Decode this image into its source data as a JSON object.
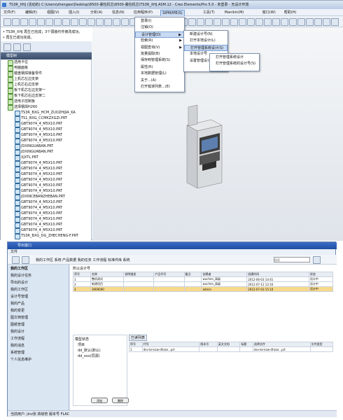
{
  "app": {
    "title": "TS3R_XHJ (活动的) C:\\Users\\zhengwx\\Desktop\\8500-暴柱机芯\\8500-暴柱机芯\\TS3R_XHJ.ASM.12 - Creo Elements/Pro 5.0 - 未登录 - 无设计环境"
  },
  "menubar": [
    "文件(F)",
    "编辑(E)",
    "视图(V)",
    "插入(I)",
    "分析(A)",
    "信息(N)",
    "应用程序(P)",
    "SIPM/IPE(S)",
    "工具(T)",
    "Manikin(M)",
    "窗口(W)",
    "帮助(H)"
  ],
  "messages": [
    "• TS3R_XHJ 再生已完成；3个弱装约件被改成功。",
    "• 再生已成功完成。"
  ],
  "nav": {
    "tabs": [
      "模型树",
      "层",
      "收藏"
    ],
    "panel_title": "模型树",
    "tree": [
      {
        "label": "选用卡位",
        "type": "asm"
      },
      {
        "label": "电脑面板",
        "type": "asm"
      },
      {
        "label": "键盘钢焊接备零件",
        "type": "asm"
      },
      {
        "label": "上机芯左边支架",
        "type": "asm"
      },
      {
        "label": "上机芯右边支架",
        "type": "asm"
      },
      {
        "label": "板下机芯左边支架一",
        "type": "asm"
      },
      {
        "label": "板下机芯右边支架二",
        "type": "asm"
      },
      {
        "label": "选电子控制板",
        "type": "asm"
      },
      {
        "label": "选择钢焊H260",
        "type": "asm"
      },
      {
        "label": "TS3R_BXG_HCM_ZUOZHIJIA_KA",
        "type": "part"
      },
      {
        "label": "TS1_BXG_CCMKZXGZI.PRT",
        "type": "part"
      },
      {
        "label": "GBT9074_4_M5X10.PRT",
        "type": "part"
      },
      {
        "label": "GBT9074_4_M5X10.PRT",
        "type": "part"
      },
      {
        "label": "GBT9074_4_M5X10.PRT",
        "type": "part"
      },
      {
        "label": "GBT9074_4_M5X10.PRT",
        "type": "part"
      },
      {
        "label": "JDXINGUABAN.PRT",
        "type": "part"
      },
      {
        "label": "JDXINGUABAN.PRT",
        "type": "part"
      },
      {
        "label": "XJXTL.PRT",
        "type": "part"
      },
      {
        "label": "GBT9074_4_M5X10.PRT",
        "type": "part"
      },
      {
        "label": "GBT9074_4_M5X10.PRT",
        "type": "part"
      },
      {
        "label": "GBT9074_4_M5X10.PRT",
        "type": "part"
      },
      {
        "label": "GBT9074_4_M5X10.PRT",
        "type": "part"
      },
      {
        "label": "GBT9074_4_M5X10.PRT",
        "type": "part"
      },
      {
        "label": "GBT9074_4_M5X10.PRT",
        "type": "part"
      },
      {
        "label": "JDXINCEBANZHEBAN.PRT",
        "type": "part"
      },
      {
        "label": "GBT9074_4_M5X10.PRT",
        "type": "part"
      },
      {
        "label": "GBT9074_4_M5X10.PRT",
        "type": "part"
      },
      {
        "label": "GBT9074_4_M5X10.PRT",
        "type": "part"
      },
      {
        "label": "GBT9074_4_M5X10.PRT",
        "type": "part"
      },
      {
        "label": "GBT9074_4_M5X10.PRT",
        "type": "part"
      },
      {
        "label": "GBT9074_4_M5X10.PRT",
        "type": "part"
      },
      {
        "label": "TS3R_BXG_DG_ZHECHENG-F.PRT",
        "type": "part"
      }
    ]
  },
  "sipm_menu": [
    {
      "label": "登录(I)",
      "sub": false
    },
    {
      "label": "注销(O)",
      "sub": false
    },
    {
      "label": "设计管理(D)",
      "sub": true,
      "active": true
    },
    {
      "label": "检索(R)",
      "sub": true
    },
    {
      "label": "视图查询(V)",
      "sub": true
    },
    {
      "label": "批量提取(B)",
      "sub": false
    },
    {
      "label": "保存到管理系统(S)",
      "sub": false
    },
    {
      "label": "属性(R)",
      "sub": false
    },
    {
      "label": "本地数据管理(L)",
      "sub": false
    },
    {
      "label": "关于...(A)",
      "sub": false
    },
    {
      "label": "打开错误列表...(E)",
      "sub": false
    }
  ],
  "design_submenu": [
    {
      "label": "新建设计号(N)"
    },
    {
      "label": "打开本地设计(L)"
    },
    {
      "label": "打开管理系统设计(S)",
      "active": true
    },
    {
      "label": "本地设计号"
    },
    {
      "label": "设置管理设计号"
    }
  ],
  "open_submenu": [
    {
      "label": "打开管理系统设计"
    },
    {
      "label": "打开管理系统的设计号(S)"
    }
  ],
  "bottom": {
    "title": "导出窗口",
    "menu": "文件",
    "breadcrumb": "我的工作区  系统  产品数据  我的任务  工作流程  标准件库  系统",
    "search_placeholder": "搜索",
    "sidebar_header": "我的工作区",
    "sidebar": [
      "我的设计任务",
      "导出的设计",
      "我的工作区",
      "设计号管理",
      "我的产品",
      "我的变更",
      "图文档管理",
      "图纸管理",
      "我的设计",
      "工作流程",
      "我的消息",
      "系统管理",
      "个人信息维护"
    ],
    "section_label": "所以设计号",
    "table_headers": [
      "序号",
      "名称",
      "说明描述",
      "产品代号",
      "备注",
      "创建者",
      "创建时间",
      "状态"
    ],
    "table_rows": [
      [
        "1",
        "整机测试",
        "",
        "",
        "",
        "wuchen_高级",
        "2012-06-03 14:41",
        "设计中"
      ],
      [
        "2",
        "新建项目",
        "",
        "",
        "",
        "wuchen_高级",
        "2012-07-12 12:16",
        "设计中"
      ],
      [
        "3",
        "3909090",
        "",
        "",
        "",
        "admin",
        "2012-07-03 15:10",
        "设计中"
      ]
    ],
    "detail_tab": "已读列表",
    "lower_left": [
      "模型状态",
      "项目",
      "dd_默认(默认)",
      "dd_xxx(同源)"
    ],
    "detail_headers": [
      "序号",
      "代号",
      "版本号",
      "英文文档",
      "标题",
      "选择文件",
      "文件类型"
    ],
    "detail_rows": [
      [
        "1",
        "dsv-ke-kzw-dhzze...prt",
        "",
        "",
        "",
        "dsv-ke-kzw-dhzze...prt",
        ""
      ]
    ],
    "buttons": [
      "添加",
      "删除"
    ],
    "status": "当前用户: jinz张 高级管 版本号 FLAC"
  }
}
